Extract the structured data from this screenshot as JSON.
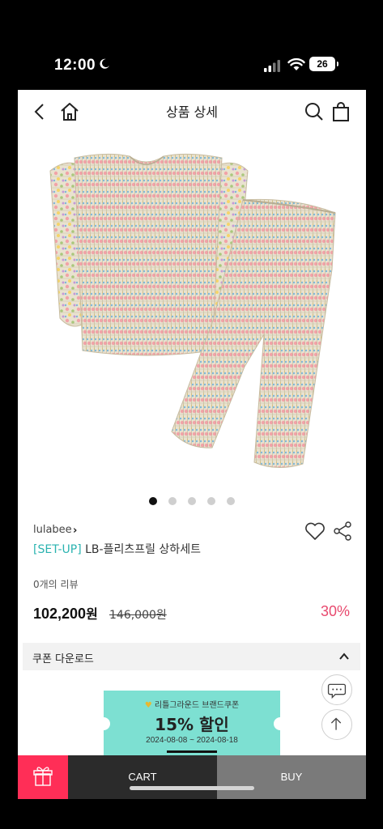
{
  "status_bar": {
    "time": "12:00",
    "battery": "26"
  },
  "header": {
    "title": "상품 상세",
    "icons": [
      "back-arrow-icon",
      "home-icon",
      "search-icon",
      "shopping-bag-icon"
    ]
  },
  "product": {
    "image_carousel": {
      "total": 5,
      "active_index": 0
    },
    "brand": "lulabee",
    "brand_chevron": "›",
    "tag": "[SET-UP]",
    "name": "LB-플리츠프릴 상하세트",
    "review_count": "0개의 리뷰",
    "price_number": "102,200",
    "price_unit": "원",
    "original_price": "146,000원",
    "discount": "30%"
  },
  "coupon": {
    "title": "쿠폰 다운로드",
    "ticket_subtitle": "리틀그라운드 브랜드쿠폰",
    "ticket_main": "15% 할인",
    "ticket_dates": "2024-08-08 ~ 2024-08-18"
  },
  "bottom": {
    "cart_label": "CART",
    "buy_label": "BUY"
  },
  "colors": {
    "accent_teal": "#2ab3b0",
    "discount_pink": "#e8496e",
    "gift_red": "#ff2e57",
    "ticket_mint": "#7de0d2"
  }
}
